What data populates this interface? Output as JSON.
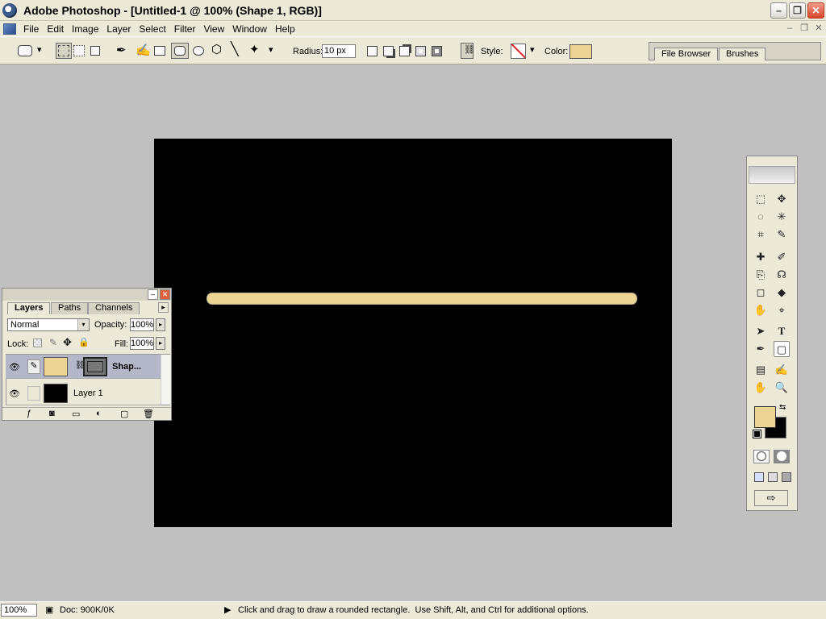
{
  "window": {
    "title": "Adobe Photoshop - [Untitled-1 @ 100% (Shape 1, RGB)]",
    "minimize_glyph": "–",
    "restore_glyph": "❐",
    "close_glyph": "✕"
  },
  "menu": [
    "File",
    "Edit",
    "Image",
    "Layer",
    "Select",
    "Filter",
    "View",
    "Window",
    "Help"
  ],
  "mdi": {
    "minimize": "–",
    "restore": "❐",
    "close": "✕"
  },
  "options": {
    "radius_label": "Radius:",
    "radius_value": "10 px",
    "style_label": "Style:",
    "color_label": "Color:",
    "shape_color": "#ecd594",
    "dropdown_glyph": "▾"
  },
  "palette_well": {
    "tabs": [
      "File Browser",
      "Brushes"
    ]
  },
  "canvas": {
    "background": "#000000",
    "shape_color": "#ecd594"
  },
  "layers_panel": {
    "tabs": [
      "Layers",
      "Paths",
      "Channels"
    ],
    "menu_glyph": "▸",
    "blend_mode": "Normal",
    "opacity_label": "Opacity:",
    "opacity_value": "100%",
    "lock_label": "Lock:",
    "fill_label": "Fill:",
    "fill_value": "100%",
    "layers": [
      {
        "name": "Shap...",
        "visible": true,
        "selected": true,
        "thumb_color": "#ecd594"
      },
      {
        "name": "Layer 1",
        "visible": true,
        "selected": false,
        "thumb_color": "#000000"
      }
    ],
    "eye_glyph": "👁",
    "footer_icons": [
      "ƒ",
      "◙",
      "▭",
      "◐",
      "▢",
      "🗑"
    ]
  },
  "toolbox": {
    "foreground_color": "#ecd594",
    "background_color": "#000000",
    "tools": [
      "⬚",
      "✥",
      "◌",
      "✳",
      "⌗",
      "✎",
      "✚",
      "✐",
      "⎘",
      "☊",
      "◻",
      "◆",
      "✋",
      "⌖",
      "➤",
      "T",
      "✒",
      "▢",
      "▤",
      "✍",
      "✋",
      "🔍"
    ]
  },
  "status": {
    "zoom": "100%",
    "doc": "Doc: 900K/0K",
    "hint": "Click and drag to draw a rounded rectangle.  Use Shift, Alt, and Ctrl for additional options.",
    "arrow_glyph": "▶"
  }
}
